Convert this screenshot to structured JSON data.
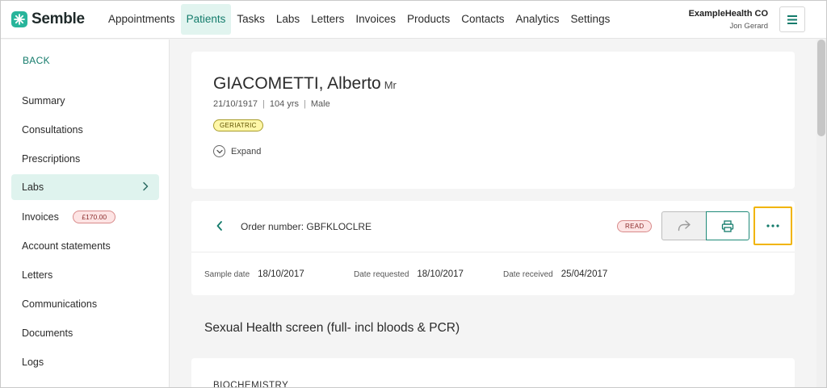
{
  "brand": {
    "name": "Semble"
  },
  "nav": {
    "items": [
      {
        "label": "Appointments",
        "active": false
      },
      {
        "label": "Patients",
        "active": true
      },
      {
        "label": "Tasks",
        "active": false
      },
      {
        "label": "Labs",
        "active": false
      },
      {
        "label": "Letters",
        "active": false
      },
      {
        "label": "Invoices",
        "active": false
      },
      {
        "label": "Products",
        "active": false
      },
      {
        "label": "Contacts",
        "active": false
      },
      {
        "label": "Analytics",
        "active": false
      },
      {
        "label": "Settings",
        "active": false
      }
    ]
  },
  "account": {
    "organisation": "ExampleHealth CO",
    "user": "Jon Gerard"
  },
  "sidebar": {
    "back_label": "BACK",
    "items": [
      {
        "label": "Summary"
      },
      {
        "label": "Consultations"
      },
      {
        "label": "Prescriptions"
      },
      {
        "label": "Labs",
        "active": true
      },
      {
        "label": "Invoices",
        "badge": "£170.00"
      },
      {
        "label": "Account statements"
      },
      {
        "label": "Letters"
      },
      {
        "label": "Communications"
      },
      {
        "label": "Documents"
      },
      {
        "label": "Logs"
      }
    ]
  },
  "patient": {
    "name": "GIACOMETTI, Alberto",
    "title": "Mr",
    "dob": "21/10/1917",
    "age": "104 yrs",
    "sex": "Male",
    "tag": "GERIATRIC",
    "expand_label": "Expand"
  },
  "order": {
    "number_label": "Order number: GBFKLOCLRE",
    "status": "READ",
    "sample_date_label": "Sample date",
    "sample_date": "18/10/2017",
    "date_requested_label": "Date requested",
    "date_requested": "18/10/2017",
    "date_received_label": "Date received",
    "date_received": "25/04/2017"
  },
  "test": {
    "title": "Sexual Health screen (full- incl bloods & PCR)",
    "section": "BIOCHEMISTRY"
  },
  "colors": {
    "brand": "#28b59b",
    "accent": "#137b6b",
    "highlight": "#f1b400",
    "tag_bg": "#fff7a8",
    "badge_bg": "#fde4e4"
  }
}
